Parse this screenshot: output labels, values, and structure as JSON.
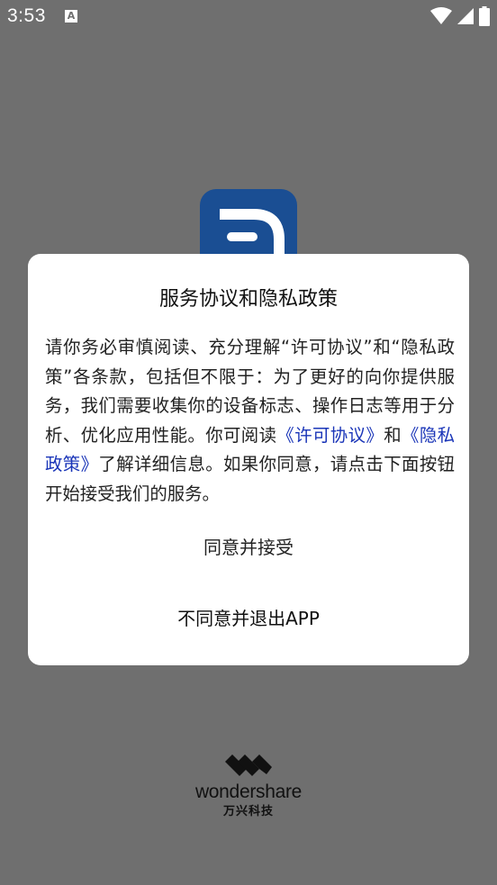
{
  "status_bar": {
    "time": "3:53",
    "notification_icon": "a-icon",
    "icons": [
      "wifi-icon",
      "signal-icon",
      "battery-icon"
    ]
  },
  "dialog": {
    "title": "服务协议和隐私政策",
    "body": {
      "text_before": "请你务必审慎阅读、充分理解“许可协议”和“隐私政策”各条款，包括但不限于：为了更好的向你提供服务，我们需要收集你的设备标志、操作日志等用于分析、优化应用性能。你可阅读",
      "license_link": "《许可协议》",
      "and_text": "和",
      "privacy_link": "《隐私政策》",
      "text_after": "了解详细信息。如果你同意，请点击下面按钮开始接受我们的服务。"
    },
    "agree_label": "同意并接受",
    "disagree_label": "不同意并退出APP"
  },
  "footer": {
    "brand_name": "wondershare",
    "brand_cn": "万兴科技"
  },
  "colors": {
    "overlay": "#6f6f6f",
    "link": "#1a35b8",
    "app_icon": "#1a4e93"
  }
}
